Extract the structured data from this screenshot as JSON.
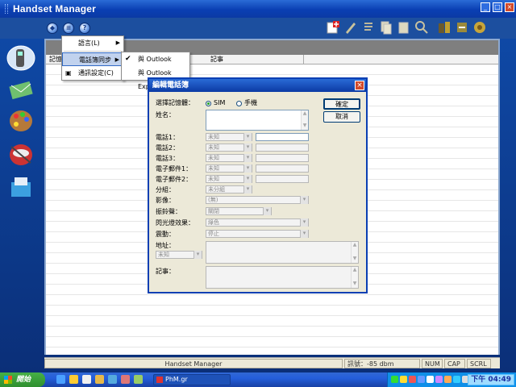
{
  "window": {
    "title": "Handset Manager"
  },
  "panel": {
    "columns": [
      "記憶",
      "記事"
    ]
  },
  "menu": {
    "items": [
      {
        "label": "語言(L)",
        "has_submenu": true
      },
      {
        "label": "電話簿同步",
        "has_submenu": true
      },
      {
        "label": "通訊設定(C)"
      }
    ],
    "submenu": [
      {
        "label": "與 Outlook",
        "checked": true
      },
      {
        "label": "與 Outlook Express",
        "checked": false
      }
    ]
  },
  "dialog": {
    "title": "編輯電話簿",
    "memory_label": "選擇記憶體：",
    "memory_options": [
      "SIM",
      "手機"
    ],
    "memory_selected": "SIM",
    "name_label": "姓名：",
    "phone_rows": [
      {
        "label": "電話1：",
        "type": "未知"
      },
      {
        "label": "電話2：",
        "type": "未知"
      },
      {
        "label": "電話3：",
        "type": "未知"
      },
      {
        "label": "電子郵件1：",
        "type": "未知"
      },
      {
        "label": "電子郵件2：",
        "type": "未知"
      }
    ],
    "group_label": "分組：",
    "group_value": "未分組",
    "image_label": "影像：",
    "image_value": "(無)",
    "ringtone_label": "振鈴聲：",
    "ringtone_value": "關閉",
    "flash_label": "閃光燈效果：",
    "flash_value": "綠色",
    "vibrate_label": "震動：",
    "vibrate_value": "停止",
    "address_label": "地址：",
    "address_type": "未知",
    "note_label": "記事：",
    "ok_label": "確定",
    "cancel_label": "取消"
  },
  "status": {
    "app": "Handset Manager",
    "signal": "訊號：-85 dbm",
    "num": "NUM",
    "cap": "CAP",
    "scrl": "SCRL"
  },
  "taskbar": {
    "start_label": "開始",
    "task_label": "PhM.gr",
    "clock": "下午 04:49"
  },
  "colors": {
    "accent": "#0a3fb3",
    "start": "#2f8f2f"
  }
}
